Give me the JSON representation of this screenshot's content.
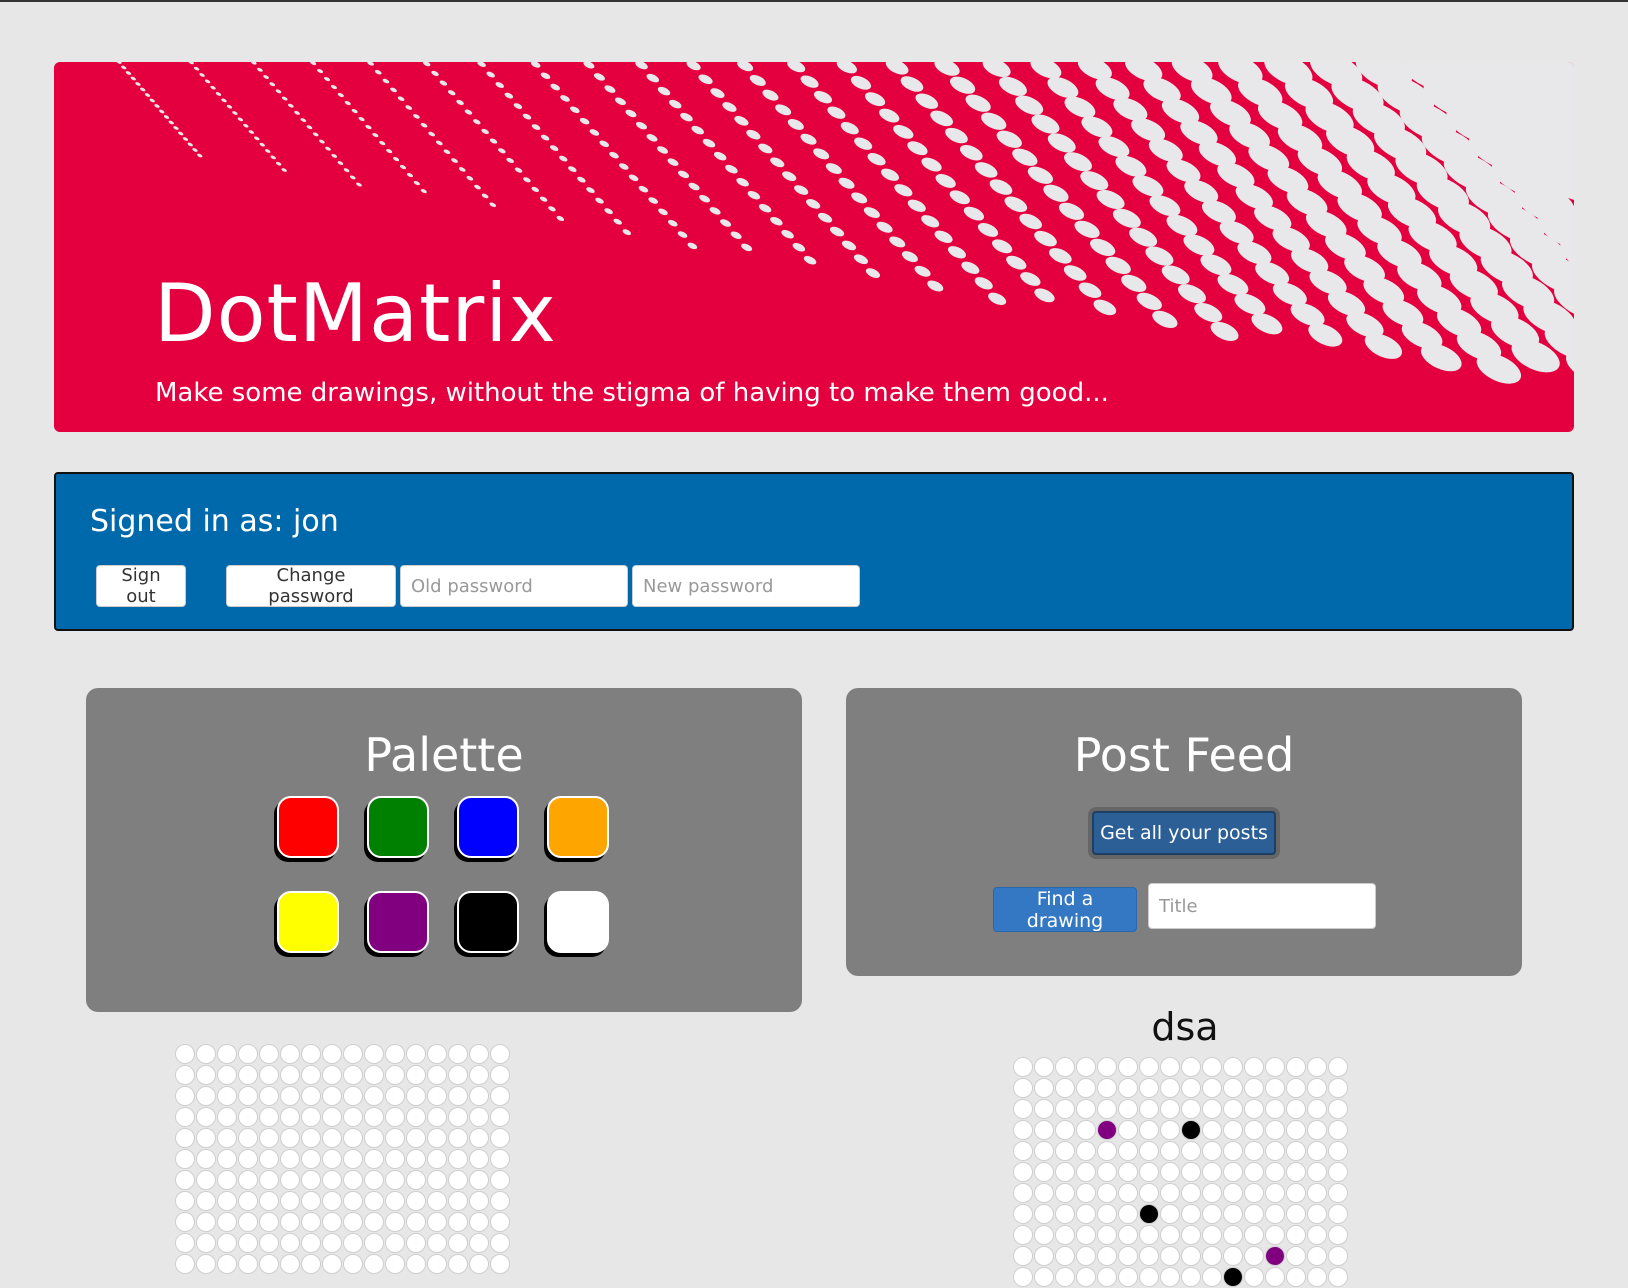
{
  "header": {
    "title": "DotMatrix",
    "subtitle": "Make some drawings, without the stigma of having to make them good..."
  },
  "account": {
    "signed_in_text": "Signed in as: jon",
    "sign_out_label": "Sign out",
    "change_password_label": "Change password",
    "old_password_placeholder": "Old password",
    "new_password_placeholder": "New password"
  },
  "palette": {
    "title": "Palette",
    "colors": [
      "#ff0000",
      "#008000",
      "#0000ff",
      "#ffa500",
      "#ffff00",
      "#800080",
      "#000000",
      "#ffffff"
    ]
  },
  "feed": {
    "title": "Post Feed",
    "get_posts_label": "Get all your posts",
    "find_drawing_label": "Find a drawing",
    "title_placeholder": "Title"
  },
  "canvas": {
    "columns": 16,
    "dot_color": "#ffffff"
  },
  "drawing": {
    "title": "dsa",
    "columns": 16,
    "filled_dots": [
      {
        "row": 3,
        "col": 4,
        "color": "#800080"
      },
      {
        "row": 3,
        "col": 8,
        "color": "#000000"
      },
      {
        "row": 7,
        "col": 6,
        "color": "#000000"
      },
      {
        "row": 9,
        "col": 12,
        "color": "#800080"
      },
      {
        "row": 10,
        "col": 10,
        "color": "#000000"
      }
    ]
  }
}
